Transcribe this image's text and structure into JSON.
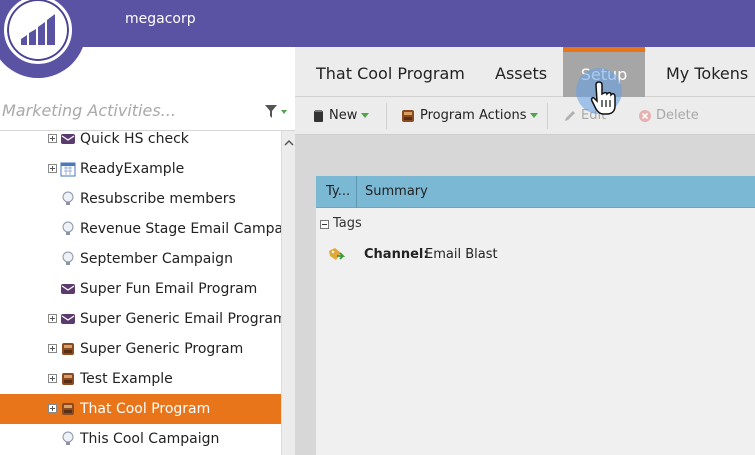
{
  "header": {
    "org_name": "megacorp",
    "brand_color": "#5a52a3",
    "accent_color": "#e8751a"
  },
  "search": {
    "placeholder": "Marketing Activities..."
  },
  "tabs": [
    {
      "label": "That Cool Program",
      "active": false
    },
    {
      "label": "Assets",
      "active": false
    },
    {
      "label": "Setup",
      "active": true
    },
    {
      "label": "My Tokens",
      "active": false
    }
  ],
  "toolbar": {
    "new_label": "New",
    "program_actions_label": "Program Actions",
    "edit_label": "Edit",
    "delete_label": "Delete"
  },
  "tree": {
    "items": [
      {
        "label": "Quick HS check",
        "expandable": true,
        "icon": "email-program-icon"
      },
      {
        "label": "ReadyExample",
        "expandable": true,
        "icon": "event-calendar-icon"
      },
      {
        "label": "Resubscribe members",
        "expandable": false,
        "icon": "campaign-lightbulb-icon"
      },
      {
        "label": "Revenue Stage Email Campaign",
        "expandable": false,
        "icon": "campaign-lightbulb-icon"
      },
      {
        "label": "September Campaign",
        "expandable": false,
        "icon": "campaign-lightbulb-icon"
      },
      {
        "label": "Super Fun Email Program",
        "expandable": false,
        "icon": "email-program-icon"
      },
      {
        "label": "Super Generic Email Program",
        "expandable": true,
        "icon": "email-program-icon"
      },
      {
        "label": "Super Generic Program",
        "expandable": true,
        "icon": "default-program-icon"
      },
      {
        "label": "Test Example",
        "expandable": true,
        "icon": "default-program-icon"
      },
      {
        "label": "That Cool Program",
        "expandable": true,
        "icon": "default-program-icon",
        "selected": true
      },
      {
        "label": "This Cool Campaign",
        "expandable": false,
        "icon": "campaign-lightbulb-icon"
      }
    ]
  },
  "grid": {
    "col_type": "Ty...",
    "col_summary": "Summary",
    "group_label": "Tags",
    "row": {
      "key": "Channel:",
      "value": "Email Blast"
    }
  }
}
